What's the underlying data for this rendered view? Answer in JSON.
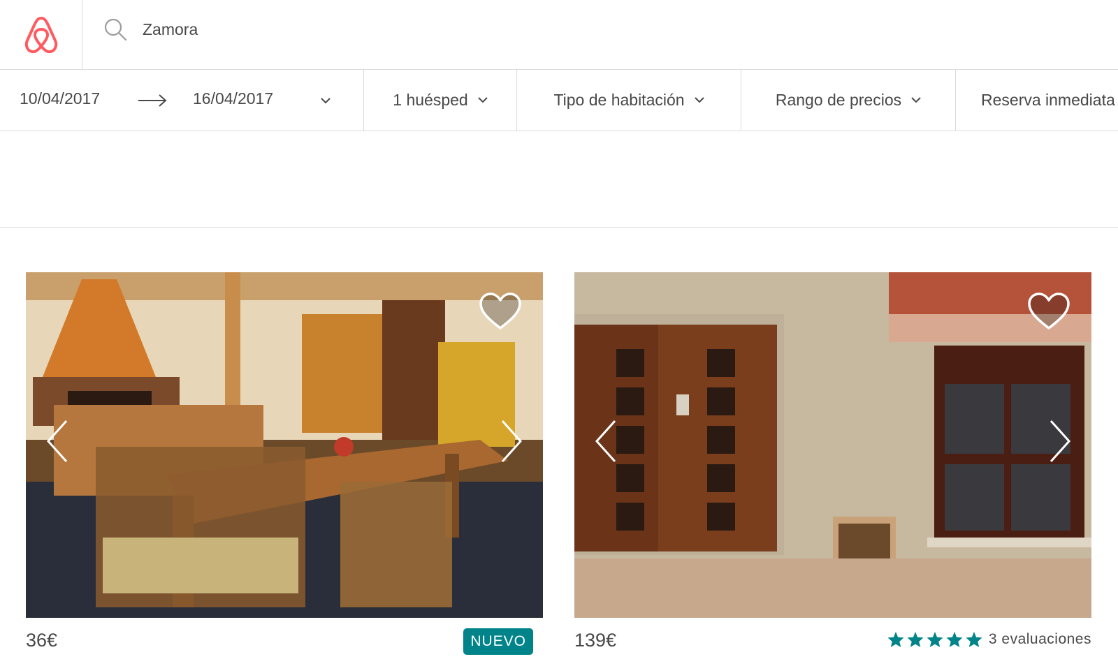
{
  "brand": {
    "accent": "#FF5A5F",
    "logo_icon": "airbnb-belo-icon"
  },
  "search": {
    "value": "Zamora",
    "icon": "search-icon"
  },
  "filters": {
    "checkin": "10/04/2017",
    "checkout": "16/04/2017",
    "guests": "1 huésped",
    "room_type": "Tipo de habitación",
    "price_range": "Rango de precios",
    "instant_book": "Reserva inmediata"
  },
  "listings": [
    {
      "price": "36€",
      "badge": "NUEVO",
      "badge_color": "#008489"
    },
    {
      "price": "139€",
      "rating_stars": 5,
      "reviews": "3 evaluaciones",
      "star_color": "#008489"
    }
  ]
}
